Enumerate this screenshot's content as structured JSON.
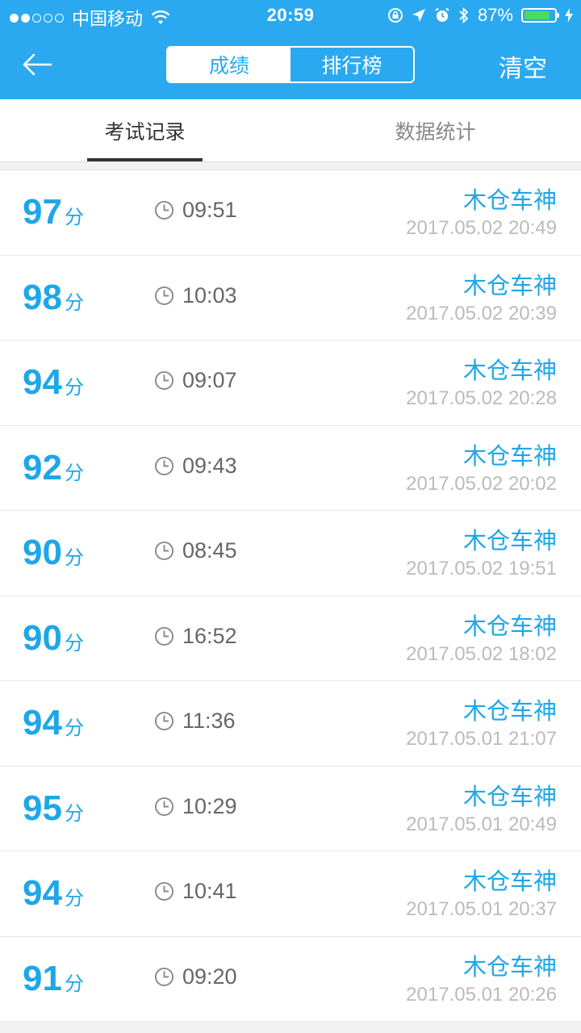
{
  "status_bar": {
    "carrier": "中国移动",
    "time": "20:59",
    "battery_percent": "87%",
    "battery_level": 0.87
  },
  "nav": {
    "segments": [
      "成绩",
      "排行榜"
    ],
    "clear_label": "清空"
  },
  "tabs": [
    "考试记录",
    "数据统计"
  ],
  "records": [
    {
      "score": "97",
      "unit": "分",
      "duration": "09:51",
      "name": "木仓车神",
      "date": "2017.05.02 20:49"
    },
    {
      "score": "98",
      "unit": "分",
      "duration": "10:03",
      "name": "木仓车神",
      "date": "2017.05.02 20:39"
    },
    {
      "score": "94",
      "unit": "分",
      "duration": "09:07",
      "name": "木仓车神",
      "date": "2017.05.02 20:28"
    },
    {
      "score": "92",
      "unit": "分",
      "duration": "09:43",
      "name": "木仓车神",
      "date": "2017.05.02 20:02"
    },
    {
      "score": "90",
      "unit": "分",
      "duration": "08:45",
      "name": "木仓车神",
      "date": "2017.05.02 19:51"
    },
    {
      "score": "90",
      "unit": "分",
      "duration": "16:52",
      "name": "木仓车神",
      "date": "2017.05.02 18:02"
    },
    {
      "score": "94",
      "unit": "分",
      "duration": "11:36",
      "name": "木仓车神",
      "date": "2017.05.01 21:07"
    },
    {
      "score": "95",
      "unit": "分",
      "duration": "10:29",
      "name": "木仓车神",
      "date": "2017.05.01 20:49"
    },
    {
      "score": "94",
      "unit": "分",
      "duration": "10:41",
      "name": "木仓车神",
      "date": "2017.05.01 20:37"
    },
    {
      "score": "91",
      "unit": "分",
      "duration": "09:20",
      "name": "木仓车神",
      "date": "2017.05.01 20:26"
    }
  ],
  "colors": {
    "header_blue": "#2aa9f0",
    "score_blue": "#1ea7e8",
    "battery_green": "#4cd964"
  },
  "icons": {
    "back": "arrow-left-icon",
    "clock": "clock-icon",
    "wifi": "wifi-icon",
    "bluetooth": "bluetooth-icon",
    "alarm": "alarm-icon",
    "location": "location-arrow-icon",
    "orientation_lock": "orientation-lock-icon",
    "charging": "charging-bolt-icon"
  }
}
